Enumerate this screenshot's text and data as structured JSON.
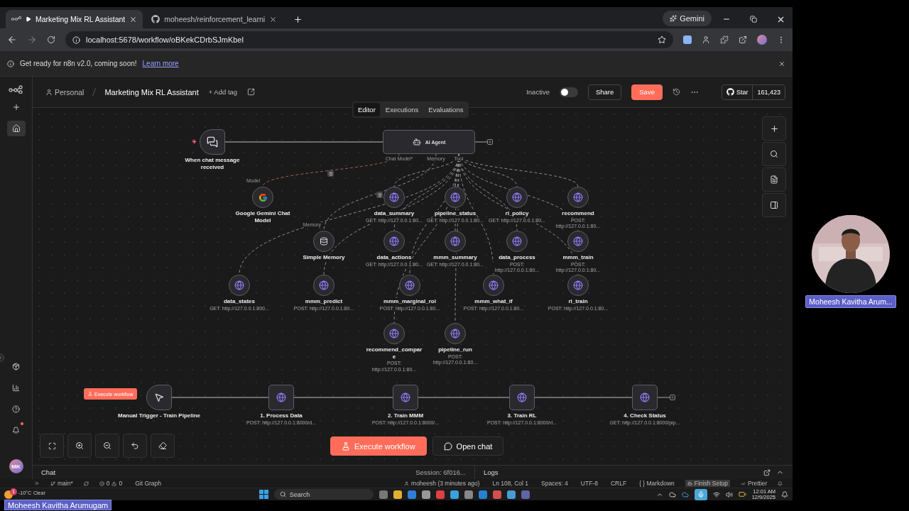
{
  "browser": {
    "tabs": [
      {
        "title": "Marketing Mix RL Assistant",
        "playing": true,
        "selected": true
      },
      {
        "title": "moheesh/reinforcement_learni",
        "playing": false,
        "selected": false
      }
    ],
    "assistant": "Gemini",
    "url": "localhost:5678/workflow/oBKekCDrbSJmKbel"
  },
  "banner": {
    "text": "Get ready for n8n v2.0, coming soon!",
    "link": "Learn more"
  },
  "sidebar": {
    "items": [
      {
        "kind": "add",
        "selected": false
      },
      {
        "kind": "home",
        "selected": true
      }
    ],
    "avatar": "MK",
    "notifications": true
  },
  "header": {
    "project": "Personal",
    "workflow": "Marketing Mix RL Assistant",
    "add_tag": "+ Add tag",
    "status": "Inactive",
    "active": false,
    "share": "Share",
    "save": "Save",
    "github": {
      "label": "Star",
      "count": "161,423"
    }
  },
  "view_tabs": [
    {
      "label": "Editor",
      "selected": true
    },
    {
      "label": "Executions",
      "selected": false
    },
    {
      "label": "Evaluations",
      "selected": false
    }
  ],
  "canvas": {
    "nodes": [
      {
        "kind": "chat_trigger",
        "label": "When chat message received"
      },
      {
        "kind": "agent",
        "label": "AI Agent",
        "ports": [
          "Chat Model*",
          "Memory",
          "Tool"
        ]
      },
      {
        "kind": "model",
        "label": "Google Gemini Chat Model",
        "port": "Model"
      },
      {
        "kind": "memory",
        "label": "Simple Memory",
        "port": "Memory"
      },
      {
        "kind": "tool",
        "label": "data_summary",
        "sublabel": "GET: http://127.0.0.1:80..."
      },
      {
        "kind": "tool",
        "label": "pipeline_status",
        "sublabel": "GET: http://127.0.0.1:80..."
      },
      {
        "kind": "tool",
        "label": "rl_policy",
        "sublabel": "GET: http://127.0.0.1:80..."
      },
      {
        "kind": "tool",
        "label": "recommend",
        "sublabel": "POST: http://127.0.0.1:80..."
      },
      {
        "kind": "tool",
        "label": "data_actions",
        "sublabel": "GET: http://127.0.0.1:80..."
      },
      {
        "kind": "tool",
        "label": "mmm_summary",
        "sublabel": "GET: http://127.0.0.1:80..."
      },
      {
        "kind": "tool",
        "label": "data_process",
        "sublabel": "POST: http://127.0.0.1:80..."
      },
      {
        "kind": "tool",
        "label": "mmm_train",
        "sublabel": "POST: http://127.0.0.1:80..."
      },
      {
        "kind": "tool",
        "label": "data_states",
        "sublabel": "GET: http://127.0.0.1:800..."
      },
      {
        "kind": "tool",
        "label": "mmm_predict",
        "sublabel": "POST: http://127.0.0.1:80..."
      },
      {
        "kind": "tool",
        "label": "mmm_marginal_roi",
        "sublabel": "POST: http://127.0.0.1:80..."
      },
      {
        "kind": "tool",
        "label": "mmm_what_if",
        "sublabel": "POST: http://127.0.0.1:80..."
      },
      {
        "kind": "tool",
        "label": "rl_train",
        "sublabel": "POST: http://127.0.0.1:80..."
      },
      {
        "kind": "tool",
        "label": "recommend_compare",
        "sublabel": "POST: http://127.0.0.1:80..."
      },
      {
        "kind": "tool",
        "label": "pipeline_run",
        "sublabel": "POST: http://127.0.0.1:80..."
      },
      {
        "kind": "manual_trigger",
        "label": "Manual Trigger - Train Pipeline"
      },
      {
        "kind": "http",
        "label": "1. Process Data",
        "sublabel": "POST: http://127.0.0.1:8000/d..."
      },
      {
        "kind": "http",
        "label": "2. Train MMM",
        "sublabel": "POST: http://127.0.0.1:8000/..."
      },
      {
        "kind": "http",
        "label": "3. Train RL",
        "sublabel": "POST: http://127.0.0.1:8000/rl..."
      },
      {
        "kind": "http",
        "label": "4. Check Status",
        "sublabel": "GET: http://127.0.0.1:8000/pip..."
      }
    ],
    "trigger_button": "Execute workflow",
    "execute": "Execute workflow",
    "open_chat": "Open chat"
  },
  "panel": {
    "chat": "Chat",
    "session": "Session: 6f016...",
    "logs": "Logs"
  },
  "status_bar": {
    "branch": "main*",
    "errors": "0",
    "warnings": "0",
    "left": "Git Graph",
    "items": [
      {
        "text": "moheesh (3 minutes ago)",
        "kind": "blame"
      },
      {
        "text": "Ln 108, Col 1",
        "kind": "plain"
      },
      {
        "text": "Spaces: 4",
        "kind": "plain"
      },
      {
        "text": "UTF-8",
        "kind": "plain"
      },
      {
        "text": "CRLF",
        "kind": "plain"
      },
      {
        "text": "{ } Markdown",
        "kind": "plain"
      },
      {
        "text": "Finish Setup",
        "kind": "highlight"
      },
      {
        "text": "Prettier",
        "kind": "check"
      }
    ]
  },
  "taskbar": {
    "weather": {
      "temp": "-10°C",
      "condition": "Clear",
      "badge": "1"
    },
    "search": "Search",
    "time": "12:01 AM",
    "date": "12/9/2025"
  },
  "presenter": {
    "name": "Moheesh Kavitha Arumugam"
  },
  "webcam": {
    "kind": "picture",
    "name": "Moheesh Kavitha Arum..."
  }
}
